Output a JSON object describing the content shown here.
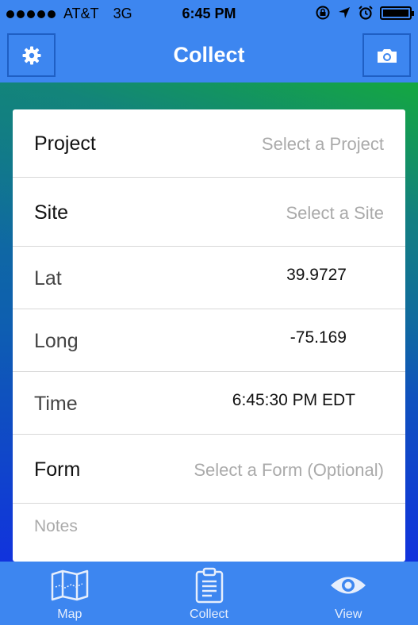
{
  "status_bar": {
    "carrier": "AT&T",
    "network": "3G",
    "time": "6:45 PM",
    "battery_level": 1.0
  },
  "nav": {
    "title": "Collect",
    "left_icon": "gear-icon",
    "right_icon": "camera-icon"
  },
  "form": {
    "rows": [
      {
        "label": "Project",
        "value": "Select a Project",
        "placeholder": true
      },
      {
        "label": "Site",
        "value": "Select a Site",
        "placeholder": true
      },
      {
        "label": "Lat",
        "value": "39.9727",
        "placeholder": false
      },
      {
        "label": "Long",
        "value": "-75.169",
        "placeholder": false
      },
      {
        "label": "Time",
        "value": "6:45:30 PM EDT",
        "placeholder": false
      },
      {
        "label": "Form",
        "value": "Select a Form (Optional)",
        "placeholder": true
      }
    ],
    "notes_placeholder": "Notes"
  },
  "tabs": [
    {
      "label": "Map",
      "icon": "map-icon"
    },
    {
      "label": "Collect",
      "icon": "clipboard-icon"
    },
    {
      "label": "View",
      "icon": "eye-icon"
    }
  ],
  "colors": {
    "accent": "#3d86f0",
    "nav_button_border": "#1f5fc4",
    "placeholder_text": "#aaaaaa"
  }
}
